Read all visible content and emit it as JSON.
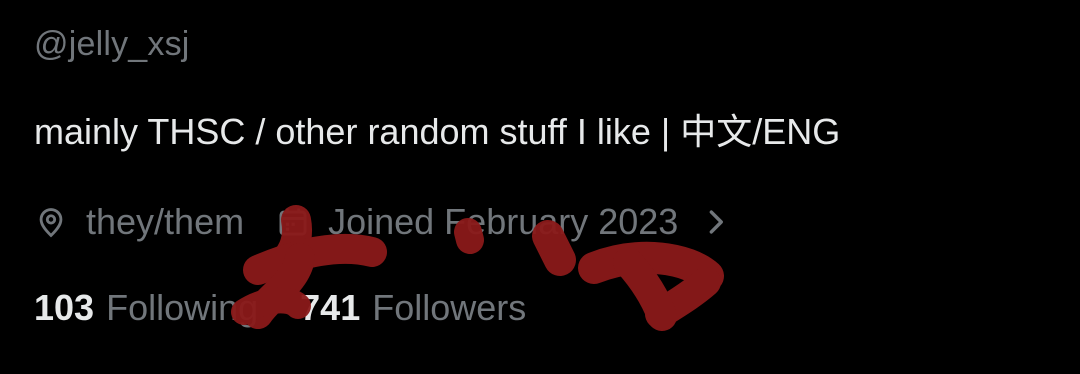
{
  "profile": {
    "handle": "@jelly_xsj",
    "bio": "mainly THSC / other random stuff I like | 中文/ENG",
    "pronouns": "they/them",
    "joined": "Joined February 2023",
    "icons": {
      "pronouns": "location-pin-icon",
      "joined": "calendar-icon",
      "expand": "chevron-right-icon"
    },
    "stats": {
      "following_count": "103",
      "following_label": "Following",
      "followers_count": "741",
      "followers_label": "Followers"
    }
  },
  "colors": {
    "background": "#000000",
    "primary_text": "#e7e9ea",
    "secondary_text": "#71767b",
    "redaction": "#8b1a1a"
  }
}
